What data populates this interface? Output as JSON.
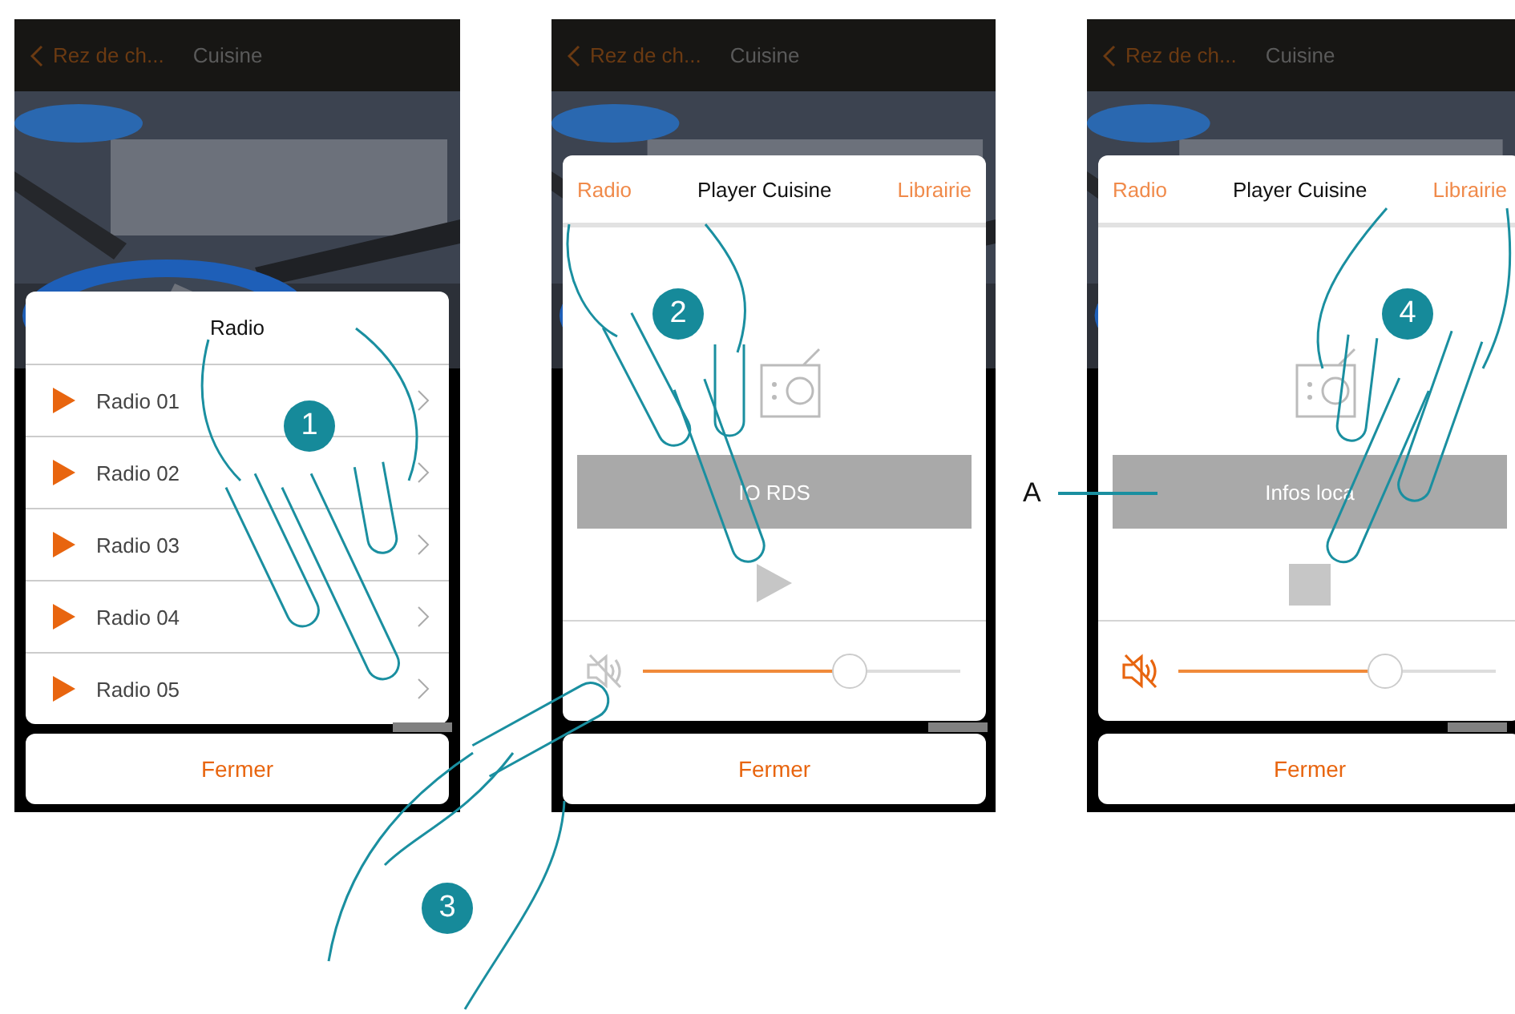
{
  "screens": [
    {
      "kind": "list",
      "header": {
        "back": "Rez de ch...",
        "title": "Cuisine"
      },
      "panel_title": "Radio",
      "items": [
        {
          "label": "Radio 01"
        },
        {
          "label": "Radio 02"
        },
        {
          "label": "Radio 03"
        },
        {
          "label": "Radio 04"
        },
        {
          "label": "Radio 05"
        }
      ],
      "close": "Fermer"
    },
    {
      "kind": "player",
      "header": {
        "back": "Rez de ch...",
        "title": "Cuisine"
      },
      "tabs": [
        {
          "label": "Radio",
          "selected": false
        },
        {
          "label": "Player Cuisine",
          "selected": true
        },
        {
          "label": "Librairie",
          "selected": false
        }
      ],
      "info": "IO RDS",
      "playing": false,
      "muted": false,
      "volume": {
        "level": 0.65
      },
      "close": "Fermer"
    },
    {
      "kind": "player",
      "header": {
        "back": "Rez de ch...",
        "title": "Cuisine"
      },
      "tabs": [
        {
          "label": "Radio",
          "selected": false
        },
        {
          "label": "Player Cuisine",
          "selected": true
        },
        {
          "label": "Librairie",
          "selected": false
        }
      ],
      "info": "Infos loca",
      "playing": true,
      "muted": true,
      "volume": {
        "level": 0.65
      },
      "close": "Fermer"
    }
  ],
  "steps": [
    {
      "number": "1"
    },
    {
      "number": "2"
    },
    {
      "number": "3"
    },
    {
      "number": "4"
    }
  ],
  "callout": {
    "label": "A"
  }
}
